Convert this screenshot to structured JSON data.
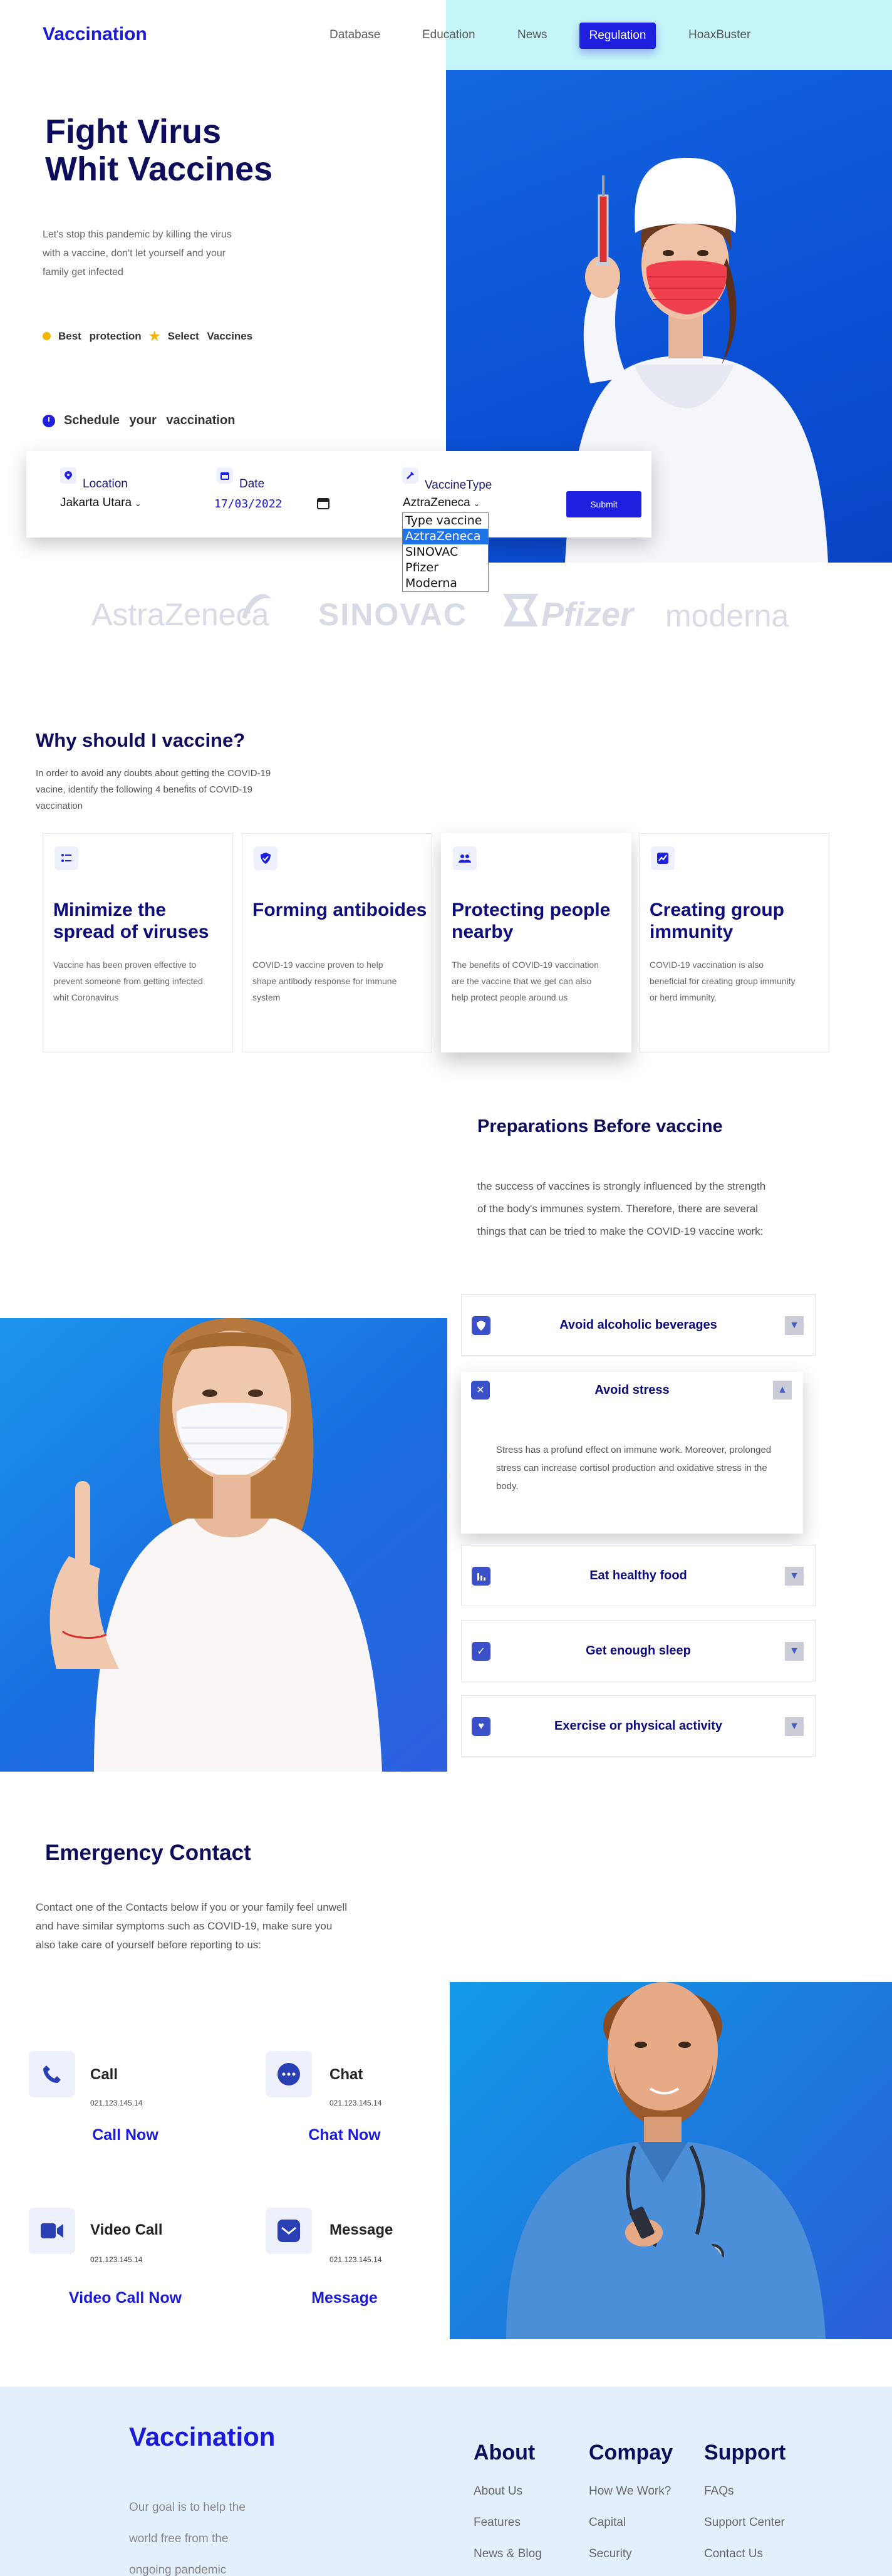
{
  "header": {
    "brand": "Vaccination",
    "nav": [
      "Database",
      "Education",
      "News",
      "Regulation",
      "HoaxBuster"
    ],
    "active": "Regulation"
  },
  "hero": {
    "title_line1": "Fight Virus",
    "title_line2": "Whit Vaccines",
    "description": "Let's stop this pandemic by killing the virus with a vaccine, don't let yourself and your family get infected",
    "bullet1": "Best protection",
    "bullet2": "Select Vaccines",
    "schedule": "Schedule your vaccination"
  },
  "form": {
    "location_label": "Location",
    "location_value": "Jakarta Utara",
    "date_label": "Date",
    "date_value": "17/03/2022",
    "type_label": "VaccineType",
    "type_value": "AztraZeneca",
    "submit": "Submit",
    "options": [
      "Type vaccine",
      "AztraZeneca",
      "SINOVAC",
      "Pfizer",
      "Moderna"
    ],
    "selected_index": 1
  },
  "brands": [
    "AstraZeneca",
    "SINOVAC",
    "Pfizer",
    "moderna"
  ],
  "why": {
    "title": "Why should I vaccine?",
    "description": "In order to avoid any doubts about getting the COVID-19 vacine, identify the following 4 benefits of COVID-19 vaccination",
    "cards": [
      {
        "icon": "list-icon",
        "title": "Minimize the spread of viruses",
        "text": "Vaccine has been proven effective to prevent someone from getting infected whit Coronavirus"
      },
      {
        "icon": "shield-icon",
        "title": "Forming antiboides",
        "text": "COVID-19 vaccine proven to help shape antibody response for immune system"
      },
      {
        "icon": "people-icon",
        "title": "Protecting people nearby",
        "text": "The benefits of COVID-19 vaccination are the vaccine that we get can also help protect people around us"
      },
      {
        "icon": "chart-icon",
        "title": "Creating group immunity",
        "text": "COVID-19 vaccination is also beneficial for creating group immunity or herd immunity."
      }
    ]
  },
  "prep": {
    "title": "Preparations Before vaccine",
    "description": "the success of vaccines is strongly influenced by the strength of the body's immunes system. Therefore, there are several things that can be tried to make the COVID-19 vaccine work:",
    "items": [
      {
        "title": "Avoid alcoholic beverages",
        "icon": "shield-icon"
      },
      {
        "title": "Avoid stress",
        "icon": "close-icon",
        "body": "Stress has a profund effect on immune work. Moreover, prolonged stress can increase cortisol production and oxidative stress in the body."
      },
      {
        "title": "Eat healthy food",
        "icon": "bar-chart-icon"
      },
      {
        "title": "Get enough sleep",
        "icon": "check-icon"
      },
      {
        "title": "Exercise or physical activity",
        "icon": "heart-icon"
      }
    ]
  },
  "emergency": {
    "title": "Emergency Contact",
    "description": "Contact one of the Contacts below if you or your family feel unwell and have similar symptoms such as COVID-19, make sure you also take care of yourself before reporting to us:",
    "contacts": [
      {
        "title": "Call",
        "number": "021.123.145.14",
        "link": "Call Now",
        "icon": "phone-icon"
      },
      {
        "title": "Chat",
        "number": "021.123.145.14",
        "link": "Chat Now",
        "icon": "chat-icon"
      },
      {
        "title": "Video Call",
        "number": "021.123.145.14",
        "link": "Video Call Now",
        "icon": "video-icon"
      },
      {
        "title": "Message",
        "number": "021.123.145.14",
        "link": "Message",
        "icon": "mail-icon"
      }
    ]
  },
  "footer": {
    "brand": "Vaccination",
    "description": "Our goal is to help the world free from the ongoing pandemic",
    "columns": [
      {
        "title": "About",
        "links": [
          "About Us",
          "Features",
          "News & Blog"
        ]
      },
      {
        "title": "Compay",
        "links": [
          "How We Work?",
          "Capital",
          "Security"
        ]
      },
      {
        "title": "Support",
        "links": [
          "FAQs",
          "Support Center",
          "Contact Us"
        ]
      }
    ]
  }
}
